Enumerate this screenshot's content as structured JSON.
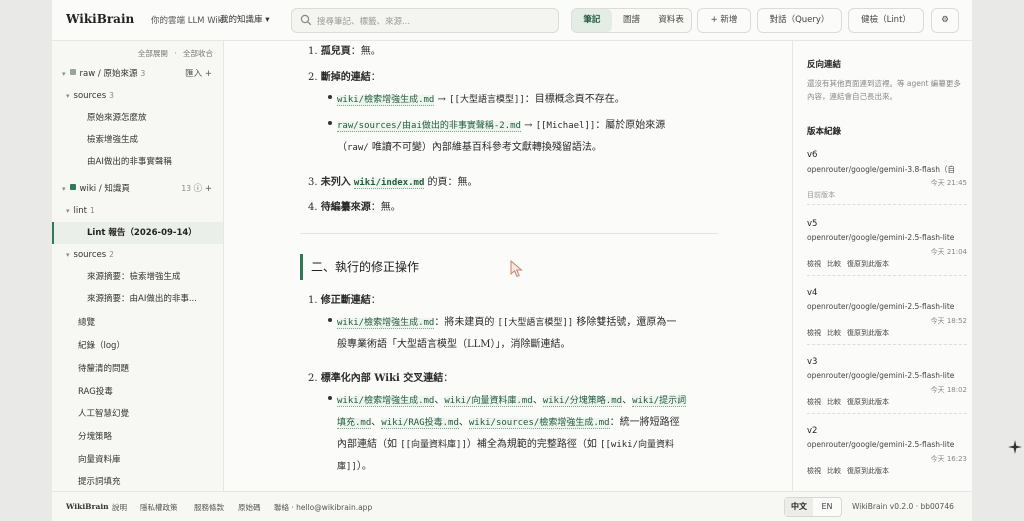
{
  "header": {
    "brand": "WikiBrain",
    "brand_sub": "你的雲端 LLM Wiki",
    "kb_select": "我的知識庫 ▾",
    "search_placeholder": "搜尋筆記、標籤、來源...",
    "view_tabs": [
      "筆記",
      "圖譜",
      "資料表"
    ],
    "new_button": "+ 新增",
    "chat_button": "對話（Query）",
    "lint_button": "健檢（Lint）",
    "settings_icon": "gear-icon"
  },
  "sidebar": {
    "expand_all": "全部展開",
    "collapse_all": "全部收合",
    "dot": "·",
    "items": [
      {
        "label": "raw / 原始來源",
        "count": "3",
        "right": "匯入  +",
        "color": "#9aa39b"
      },
      {
        "label": "sources",
        "count": "3"
      },
      {
        "label": "原始來源怎麼放"
      },
      {
        "label": "檢索增強生成"
      },
      {
        "label": "由AI做出的非事實聲稱"
      },
      {
        "label": "wiki / 知識頁",
        "count": "13",
        "right": "ⓘ  +",
        "color": "#2f7a52"
      },
      {
        "label": "lint",
        "count": "1"
      },
      {
        "label": "Lint 報告（2026-09-14）"
      },
      {
        "label": "sources",
        "count": "2"
      },
      {
        "label": "來源摘要：檢索增強生成"
      },
      {
        "label": "來源摘要：由AI做出的非事..."
      },
      {
        "label": "總覽"
      },
      {
        "label": "紀錄（log）"
      },
      {
        "label": "待釐清的問題"
      },
      {
        "label": "RAG投毒"
      },
      {
        "label": "人工智慧幻覺"
      },
      {
        "label": "分塊策略"
      },
      {
        "label": "向量資料庫"
      },
      {
        "label": "提示詞填充"
      }
    ]
  },
  "content": {
    "l1_num": "1.",
    "l1_b": "孤兒頁",
    "l1_rest": "：無。",
    "l2_num": "2.",
    "l2_b": "斷掉的連結",
    "l2_rest": "：",
    "b1_link": "wiki/檢索增強生成.md",
    "b1_arrow": " → ",
    "b1_code": "[[大型語言模型]]",
    "b1_rest": "：目標概念頁不存在。",
    "b2_link": "raw/sources/由ai做出的非事實聲稱-2.md",
    "b2_arrow": " → ",
    "b2_code": "[[Michael]]",
    "b2_rest": "：屬於原始來源",
    "b2_line2_a": "（",
    "b2_line2_code": "raw/",
    "b2_line2_rest": " 唯讀不可變）內部維基百科參考文獻轉換殘留語法。",
    "l3_num": "3.",
    "l3_b": "未列入",
    "l3_link": "wiki/index.md",
    "l3_rest": " 的頁：無。",
    "l4_num": "4.",
    "l4_b": "待編纂來源",
    "l4_rest": "：無。",
    "h2": "二、執行的修正操作",
    "m1_num": "1.",
    "m1_b": "修正斷連結",
    "m1_rest": "：",
    "m1b_link": "wiki/檢索增強生成.md",
    "m1b_a": "：將未建頁的 ",
    "m1b_code": "[[大型語言模型]]",
    "m1b_b": " 移除雙括號，還原為一",
    "m1b_line2": "般專業術語「大型語言模型（LLM）」，消除斷連結。",
    "m2_num": "2.",
    "m2_b": "標準化內部 Wiki 交叉連結",
    "m2_rest": "：",
    "m2_link1": "wiki/檢索增強生成.md",
    "m2_link2": "wiki/向量資料庫.md",
    "m2_link3": "wiki/分塊策略.md",
    "m2_link4": "wiki/提示詞",
    "m2_link4b": "填充.md",
    "m2_link5": "wiki/RAG投毒.md",
    "m2_link6": "wiki/sources/檢索增強生成.md",
    "m2_sep": "、",
    "m2_after": "：統一將短路徑",
    "m2_line3_a": "內部連結（如 ",
    "m2_line3_code": "[[向量資料庫]]",
    "m2_line3_b": "）補全為規範的完整路徑（如 ",
    "m2_line3_code2": "[[wiki/向量資料",
    "m2_line4_code": "庫]]",
    "m2_line4_rest": "）。"
  },
  "right_panel": {
    "backlinks_title": "反向連結",
    "backlinks_desc": "還沒有其他頁面連到這裡。等 agent 編纂更多內容，連結會自己長出來。",
    "versions_title": "版本紀錄",
    "versions": [
      {
        "v": "v6",
        "model": "openrouter/google/gemini-3.8-flash（自",
        "time": "今天 21:45",
        "current": "目前版本"
      },
      {
        "v": "v5",
        "model": "openrouter/google/gemini-2.5-flash-lite",
        "time": "今天 21:04",
        "actions": [
          "檢視",
          "比較",
          "復原到此版本"
        ]
      },
      {
        "v": "v4",
        "model": "openrouter/google/gemini-2.5-flash-lite",
        "time": "今天 18:52",
        "actions": [
          "檢視",
          "比較",
          "復原到此版本"
        ]
      },
      {
        "v": "v3",
        "model": "openrouter/google/gemini-2.5-flash-lite",
        "time": "今天 18:02",
        "actions": [
          "檢視",
          "比較",
          "復原到此版本"
        ]
      },
      {
        "v": "v2",
        "model": "openrouter/google/gemini-2.5-flash-lite",
        "time": "今天 16:23",
        "actions": [
          "檢視",
          "比較",
          "復原到此版本"
        ]
      }
    ]
  },
  "footer": {
    "brand": "WikiBrain",
    "links": [
      "說明",
      "隱私權政策",
      "服務條款",
      "原始碼",
      "聯絡 · hello@wikibrain.app"
    ],
    "lang": [
      "中文",
      "EN"
    ],
    "version": "WikiBrain v0.2.0 · bb00746"
  },
  "colors": {
    "accent": "#2f7a52",
    "background": "#fbfbf9"
  }
}
